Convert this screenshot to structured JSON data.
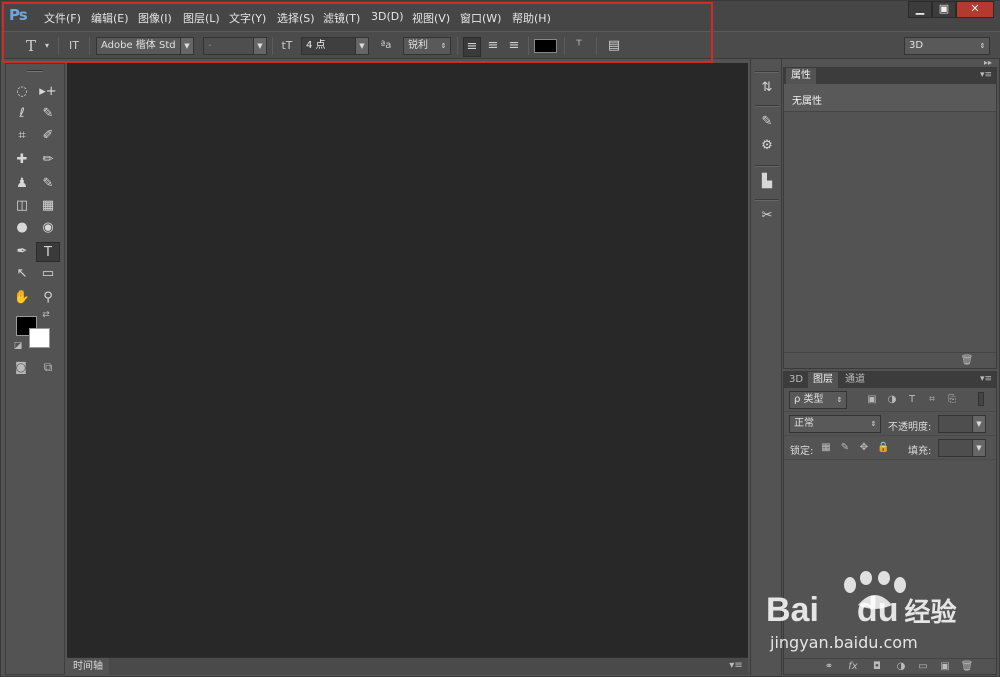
{
  "app": {
    "logo": "Ps"
  },
  "menu": [
    "文件(F)",
    "编辑(E)",
    "图像(I)",
    "图层(L)",
    "文字(Y)",
    "选择(S)",
    "滤镜(T)",
    "3D(D)",
    "视图(V)",
    "窗口(W)",
    "帮助(H)"
  ],
  "window_controls": {
    "minimize": "▁",
    "maximize": "▣",
    "close": "✕"
  },
  "options": {
    "tool_glyph": "T",
    "orientation_glyph": "IT",
    "font_family": "Adobe 楷体 Std",
    "font_style": "-",
    "size_glyph": "tT",
    "font_size": "4 点",
    "aa_glyph": "ªa",
    "antialias": "锐利",
    "align_left": "≡",
    "align_center": "≡",
    "align_right": "≡",
    "text_color": "#000000",
    "warp_glyph": "⸆",
    "panel_glyph": "▤",
    "workspace": "3D"
  },
  "tools": [
    [
      "◌",
      "▸+"
    ],
    [
      "ℓ",
      "✎"
    ],
    [
      "⌗",
      "✐"
    ],
    [
      "✚",
      "✏"
    ],
    [
      "♟",
      "✎"
    ],
    [
      "◫",
      "▦"
    ],
    [
      "●",
      "◉"
    ],
    [
      "✒",
      "T"
    ],
    [
      "↖",
      "▭"
    ],
    [
      "✋",
      "⚲"
    ]
  ],
  "colors": {
    "foreground": "#000000",
    "background": "#ffffff"
  },
  "timeline": {
    "label": "时间轴",
    "menu": "▾≡"
  },
  "dock": [
    "⇅",
    "✎",
    "⚙",
    "▙",
    "✂"
  ],
  "properties": {
    "tab": "属性",
    "content": "无属性",
    "menu": "▾≡",
    "trash": "🗑"
  },
  "layers": {
    "tabs": [
      "3D",
      "图层",
      "通道"
    ],
    "filter_kind": "ρ 类型",
    "blend_mode": "正常",
    "opacity_label": "不透明度:",
    "lock_label": "锁定:",
    "fill_label": "填充:",
    "menu": "▾≡",
    "footer": [
      "⚭",
      "fx",
      "◘",
      "◑",
      "▭",
      "▣",
      "🗑"
    ]
  },
  "watermark": {
    "brand": "Bai",
    "brand2": "du",
    "cn": "经验",
    "url": "jingyan.baidu.com"
  }
}
